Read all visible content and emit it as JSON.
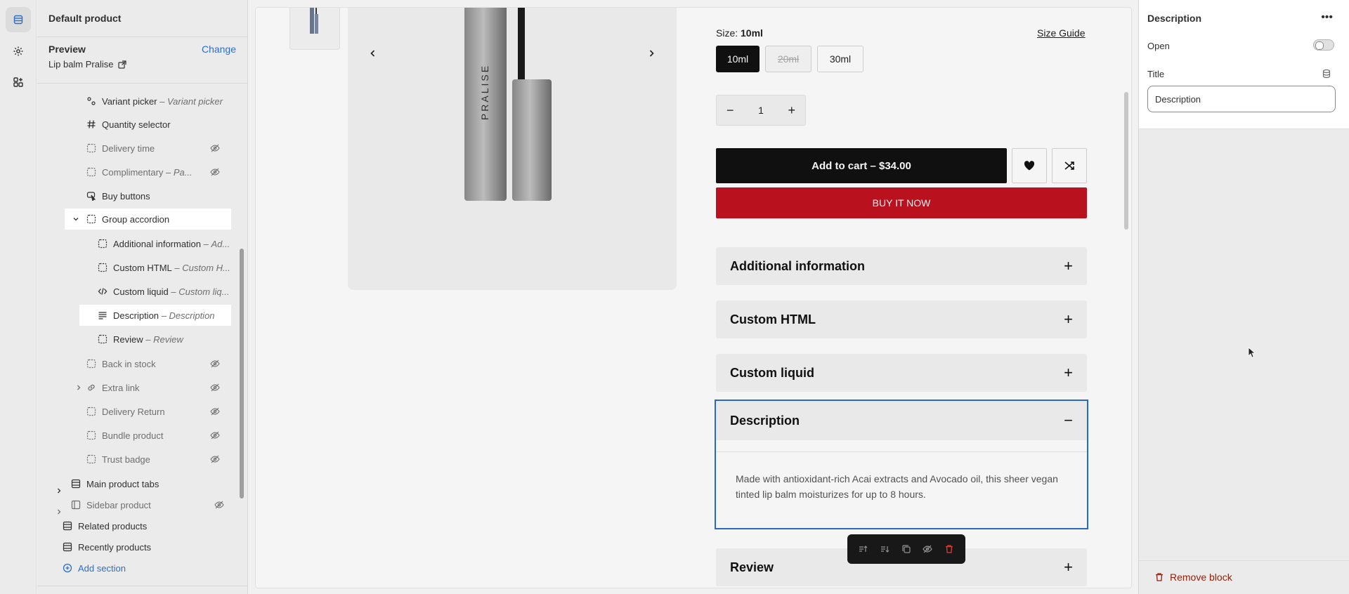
{
  "sidebar": {
    "title": "Default product",
    "preview_label": "Preview",
    "change_label": "Change",
    "preview_value": "Lip balm Pralise",
    "items": [
      {
        "label": "Variant picker",
        "sub": "Variant picker",
        "icon": "variant-icon",
        "hidden": false
      },
      {
        "label": "Quantity selector",
        "sub": "",
        "icon": "hash-icon",
        "hidden": false
      },
      {
        "label": "Delivery time",
        "sub": "",
        "icon": "block-icon",
        "hidden": true
      },
      {
        "label": "Complimentary",
        "sub": "Pa...",
        "icon": "block-icon",
        "hidden": true
      },
      {
        "label": "Buy buttons",
        "sub": "",
        "icon": "cursor-click-icon",
        "hidden": false
      },
      {
        "label": "Group accordion",
        "sub": "",
        "icon": "block-icon",
        "hidden": false
      },
      {
        "label": "Additional information",
        "sub": "Ad...",
        "icon": "block-icon",
        "hidden": false
      },
      {
        "label": "Custom HTML",
        "sub": "Custom H...",
        "icon": "block-icon",
        "hidden": false
      },
      {
        "label": "Custom liquid",
        "sub": "Custom liq...",
        "icon": "code-icon",
        "hidden": false
      },
      {
        "label": "Description",
        "sub": "Description",
        "icon": "text-align-icon",
        "hidden": false
      },
      {
        "label": "Review",
        "sub": "Review",
        "icon": "block-icon",
        "hidden": false
      },
      {
        "label": "Back in stock",
        "sub": "",
        "icon": "block-icon",
        "hidden": true
      },
      {
        "label": "Extra link",
        "sub": "",
        "icon": "link-icon",
        "hidden": true
      },
      {
        "label": "Delivery Return",
        "sub": "",
        "icon": "block-icon",
        "hidden": true
      },
      {
        "label": "Bundle product",
        "sub": "",
        "icon": "block-icon",
        "hidden": true
      },
      {
        "label": "Trust badge",
        "sub": "",
        "icon": "block-icon",
        "hidden": true
      },
      {
        "label": "Main product tabs",
        "sub": "",
        "icon": "section-icon",
        "hidden": false
      },
      {
        "label": "Sidebar product",
        "sub": "",
        "icon": "sidebar-section-icon",
        "hidden": true
      },
      {
        "label": "Related products",
        "sub": "",
        "icon": "section-icon",
        "hidden": false
      },
      {
        "label": "Recently products",
        "sub": "",
        "icon": "section-icon",
        "hidden": false
      }
    ],
    "add_section": "Add section"
  },
  "preview": {
    "product_logo_text": "PRALISE",
    "size_label": "Size:",
    "size_value": "10ml",
    "size_guide": "Size Guide",
    "sizes": [
      {
        "label": "10ml",
        "state": "selected"
      },
      {
        "label": "20ml",
        "state": "unavailable"
      },
      {
        "label": "30ml",
        "state": "available"
      }
    ],
    "quantity": "1",
    "add_to_cart": "Add to cart",
    "price": "$34.00",
    "buy_now": "BUY IT NOW",
    "accordions": [
      {
        "title": "Additional information"
      },
      {
        "title": "Custom HTML"
      },
      {
        "title": "Custom liquid"
      }
    ],
    "description": {
      "title": "Description",
      "body": "Made with antioxidant-rich Acai extracts and Avocado oil, this sheer vegan tinted lip balm moisturizes for up to 8 hours."
    },
    "review_title": "Review"
  },
  "panel": {
    "title": "Description",
    "open_label": "Open",
    "title_label": "Title",
    "title_value": "Description",
    "remove_label": "Remove block"
  },
  "colors": {
    "accent": "#2c6ecb",
    "buy_now": "#c1121f",
    "remove": "#8e1f0b"
  }
}
